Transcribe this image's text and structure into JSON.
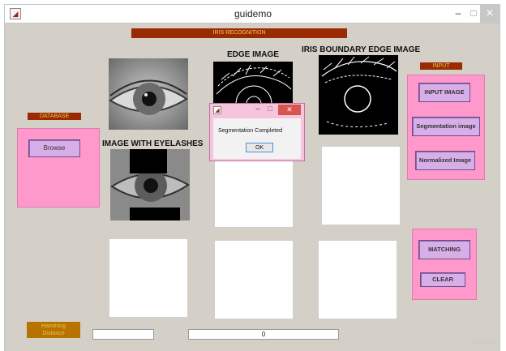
{
  "window": {
    "title": "guidemo",
    "minimize": "–",
    "maximize": "□",
    "close": "✕"
  },
  "banner": {
    "title": "IRIS RECOGNITION"
  },
  "headings": {
    "edge_image": "EDGE IMAGE",
    "iris_boundary": "IRIS BOUNDARY EDGE IMAGE",
    "eyelashes": "IMAGE WITH EYELASHES"
  },
  "database": {
    "label": "DATABASE",
    "browse": "Browse"
  },
  "input_panel": {
    "label": "INPUT",
    "input_image": "INPUT IMAGE",
    "segmentation": "Segmentation image",
    "normalized": "Normalized Image"
  },
  "match_panel": {
    "matching": "MATCHING",
    "clear": "CLEAR"
  },
  "hamming": {
    "label_line1": "Hamming",
    "label_line2": "Distance",
    "value": "",
    "result": "0"
  },
  "dialog": {
    "message": "Segmentation Completed",
    "ok": "OK",
    "minimize": "–",
    "maximize": "□",
    "close": "✕"
  },
  "watermark": "Activat",
  "colors": {
    "accent_pink": "#ff99cc",
    "banner": "#9a2a02",
    "button": "#d8aee8",
    "background": "#d4d0c8"
  }
}
